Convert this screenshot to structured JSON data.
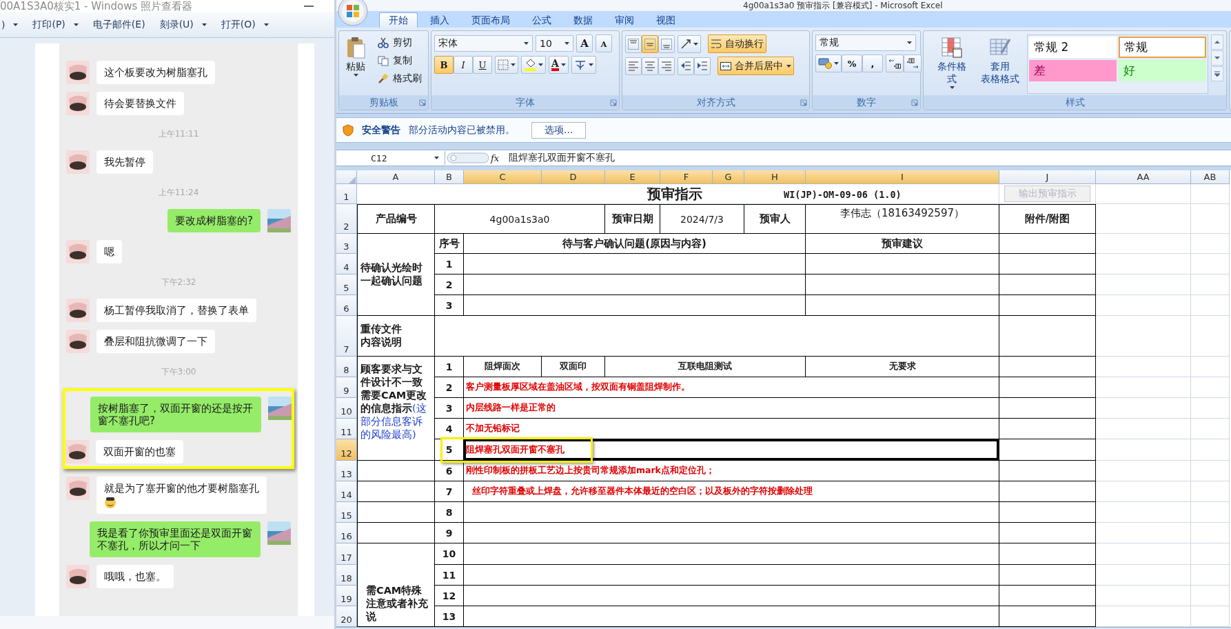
{
  "photo_viewer": {
    "title": "00A1S3A0核实1 - Windows 照片查看器",
    "menu": [
      {
        "label": ")",
        "dropdown": true
      },
      {
        "label": "打印(P)",
        "dropdown": true
      },
      {
        "label": "电子邮件(E)",
        "dropdown": false
      },
      {
        "label": "刻录(U)",
        "dropdown": true
      },
      {
        "label": "打开(O)",
        "dropdown": true
      }
    ],
    "chat": [
      {
        "kind": "incoming",
        "text": "这个板要改为树脂塞孔"
      },
      {
        "kind": "incoming",
        "text": "待会要替换文件"
      },
      {
        "kind": "time",
        "text": "上午11:11"
      },
      {
        "kind": "incoming",
        "text": "我先暂停"
      },
      {
        "kind": "time",
        "text": "上午11:24"
      },
      {
        "kind": "outgoing",
        "text": "要改成树脂塞的?"
      },
      {
        "kind": "incoming",
        "text": "嗯"
      },
      {
        "kind": "time",
        "text": "下午2:32"
      },
      {
        "kind": "incoming",
        "text": "杨工暂停我取消了，替换了表单"
      },
      {
        "kind": "incoming",
        "text": "叠层和阻抗微调了一下"
      },
      {
        "kind": "time",
        "text": "下午3:00"
      },
      {
        "kind": "highlight",
        "messages": [
          {
            "kind": "outgoing",
            "text": "按树脂塞了，双面开窗的还是按开窗不塞孔吧?"
          },
          {
            "kind": "incoming",
            "text": "双面开窗的也塞"
          }
        ]
      },
      {
        "kind": "incoming",
        "text": "就是为了塞开窗的他才要树脂塞孔",
        "emoji": true
      },
      {
        "kind": "outgoing",
        "text": "我是看了你预审里面还是双面开窗不塞孔，所以才问一下"
      },
      {
        "kind": "incoming",
        "text": "哦哦，也塞。"
      }
    ]
  },
  "excel": {
    "title": "4g00a1s3a0 预审指示 [兼容模式] - Microsoft Excel",
    "tabs": [
      {
        "label": "开始",
        "selected": true
      },
      {
        "label": "插入",
        "selected": false
      },
      {
        "label": "页面布局",
        "selected": false
      },
      {
        "label": "公式",
        "selected": false
      },
      {
        "label": "数据",
        "selected": false
      },
      {
        "label": "审阅",
        "selected": false
      },
      {
        "label": "视图",
        "selected": false
      }
    ],
    "groups": [
      {
        "kind": "clipboard",
        "label": "剪贴板",
        "launcher": true,
        "paste": "粘贴",
        "actions": [
          "剪切",
          "复制",
          "格式刷"
        ]
      },
      {
        "kind": "font",
        "label": "字体",
        "launcher": true,
        "font": "宋体",
        "size": "10",
        "grow": "A",
        "shrink": "A",
        "styles": [
          {
            "glyph": "B",
            "selected": true
          },
          {
            "glyph": "I",
            "selected": false
          },
          {
            "glyph": "U",
            "selected": false
          }
        ],
        "font_color": "A"
      },
      {
        "kind": "alignment",
        "label": "对齐方式",
        "launcher": true,
        "vertical": [
          {
            "selected": false
          },
          {
            "selected": true
          },
          {
            "selected": false
          }
        ],
        "wrap": {
          "label": "自动换行",
          "selected": true
        },
        "merge": {
          "label": "合并后居中",
          "selected": true
        }
      },
      {
        "kind": "number",
        "label": "数字",
        "launcher": true,
        "format": "常规",
        "symbols": [
          "%",
          ","
        ]
      },
      {
        "kind": "styles",
        "label": "样式",
        "launcher": false,
        "conditional": "条件格式",
        "table_format": [
          "套用",
          "表格格式"
        ],
        "gallery": [
          {
            "label": "常规 2",
            "kind": "normal",
            "color": "#ffffff",
            "selected": false
          },
          {
            "label": "常规",
            "kind": "normal",
            "color": "#ffffff",
            "selected": true
          },
          {
            "label": "差",
            "kind": "bad",
            "color": "#ff99cc",
            "selected": false
          },
          {
            "label": "好",
            "kind": "good",
            "color": "#ccffcc",
            "selected": false
          }
        ]
      }
    ],
    "security": {
      "title": "安全警告",
      "message": "部分活动内容已被禁用。",
      "button": "选项..."
    },
    "formula_bar": {
      "name_box": "C12",
      "fx": "fx",
      "formula": "阻焊塞孔双面开窗不塞孔"
    },
    "sheet": {
      "columns": [
        {
          "label": "A",
          "selected": false
        },
        {
          "label": "B",
          "selected": false
        },
        {
          "label": "C",
          "selected": true
        },
        {
          "label": "D",
          "selected": true
        },
        {
          "label": "E",
          "selected": true
        },
        {
          "label": "F",
          "selected": true
        },
        {
          "label": "G",
          "selected": true
        },
        {
          "label": "H",
          "selected": true
        },
        {
          "label": "I",
          "selected": true
        },
        {
          "label": "J",
          "selected": false
        },
        {
          "label": "AA",
          "selected": false
        },
        {
          "label": "AB",
          "selected": false
        }
      ],
      "rows": [
        {
          "label": "1",
          "selected": false,
          "highlighted": false,
          "cells": [
            "",
            "",
            "",
            "",
            "",
            {
              "kind": "title",
              "text": "预审指示",
              "selected": false
            },
            "",
            {
              "kind": "code",
              "text": "WI(JP)-OM-09-06 (1.0)",
              "selected": false
            },
            "",
            {
              "kind": "button",
              "text": "输出预审指示",
              "disabled": true,
              "selected": false
            }
          ]
        },
        {
          "label": "2",
          "selected": false,
          "highlighted": false,
          "cells": [
            {
              "kind": "header",
              "text": "产品编号",
              "selected": false
            },
            "",
            {
              "kind": "value",
              "text": "4g00a1s3a0",
              "selected": false
            },
            "",
            {
              "kind": "header",
              "text": "预审日期",
              "selected": false
            },
            {
              "kind": "value",
              "text": "2024/7/3",
              "selected": false
            },
            "",
            {
              "kind": "header",
              "text": "预审人",
              "selected": false
            },
            {
              "kind": "top-value",
              "text": "李伟志（18163492597）",
              "selected": false
            },
            {
              "kind": "header",
              "text": "附件/附图",
              "selected": false
            }
          ]
        },
        {
          "label": "3",
          "selected": false,
          "highlighted": false,
          "cells": [
            {
              "kind": "side",
              "text": "待确认光绘时一起确认问题",
              "selected": false
            },
            {
              "kind": "header",
              "text": "序号",
              "selected": false
            },
            {
              "kind": "header",
              "text": "待与客户确认问题(原因与内容)",
              "selected": false
            },
            "",
            "",
            "",
            "",
            "",
            {
              "kind": "header",
              "text": "预审建议",
              "selected": false
            }
          ]
        },
        {
          "label": "4",
          "selected": false,
          "highlighted": false,
          "cells": [
            "",
            {
              "kind": "number",
              "text": "1",
              "selected": false
            }
          ]
        },
        {
          "label": "5",
          "selected": false,
          "highlighted": false,
          "cells": [
            "",
            {
              "kind": "number",
              "text": "2",
              "selected": false
            }
          ]
        },
        {
          "label": "6",
          "selected": false,
          "highlighted": false,
          "cells": [
            "",
            {
              "kind": "number",
              "text": "3",
              "selected": false
            }
          ]
        },
        {
          "label": "7",
          "selected": false,
          "highlighted": false,
          "cells": [
            {
              "kind": "side",
              "text": "重传文件内容说明",
              "selected": false
            }
          ]
        },
        {
          "label": "8",
          "selected": false,
          "highlighted": false,
          "cells": [
            {
              "kind": "side",
              "text": "顾客要求与文件设计不一致需要CAM更改的信息指示",
              "note": "(这部分信息客诉的风险最高)",
              "selected": false
            },
            {
              "kind": "number",
              "text": "1",
              "selected": false
            },
            {
              "kind": "small-header",
              "text": "阻焊面次",
              "selected": false
            },
            {
              "kind": "small-header",
              "text": "双面印",
              "selected": false
            },
            "",
            {
              "kind": "small-header",
              "text": "互联电阻测试",
              "selected": false
            },
            "",
            "",
            {
              "kind": "small-header",
              "text": "无要求",
              "selected": false
            }
          ]
        },
        {
          "label": "9",
          "selected": false,
          "highlighted": false,
          "cells": [
            "",
            {
              "kind": "number",
              "text": "2",
              "selected": false
            },
            {
              "kind": "red",
              "text": "客户测量板厚区域在盖油区域，按双面有铜盖阻焊制作。",
              "selected": false
            }
          ]
        },
        {
          "label": "10",
          "selected": false,
          "highlighted": false,
          "cells": [
            "",
            {
              "kind": "number",
              "text": "3",
              "selected": false
            },
            {
              "kind": "red",
              "text": "内层线路一样是正常的",
              "selected": false
            }
          ]
        },
        {
          "label": "11",
          "selected": false,
          "highlighted": false,
          "cells": [
            "",
            {
              "kind": "number",
              "text": "4",
              "selected": false
            },
            {
              "kind": "red",
              "text": "不加无铅标记",
              "selected": false
            }
          ]
        },
        {
          "label": "12",
          "selected": true,
          "highlighted": true,
          "cells": [
            "",
            {
              "kind": "number",
              "text": "5",
              "selected": false
            },
            {
              "kind": "red",
              "text": "阻焊塞孔双面开窗不塞孔",
              "selected": true
            }
          ]
        },
        {
          "label": "13",
          "selected": false,
          "highlighted": false,
          "cells": [
            "",
            {
              "kind": "number",
              "text": "6",
              "selected": false
            },
            {
              "kind": "red",
              "text": "刚性印制板的拼板工艺边上按贵司常规添加mark点和定位孔；",
              "selected": false
            }
          ]
        },
        {
          "label": "14",
          "selected": false,
          "highlighted": false,
          "cells": [
            "",
            {
              "kind": "number",
              "text": "7",
              "selected": false
            },
            {
              "kind": "red",
              "text": "  丝印字符重叠或上焊盘，允许移至器件本体最近的空白区；以及板外的字符按删除处理",
              "selected": false
            }
          ]
        },
        {
          "label": "15",
          "selected": false,
          "highlighted": false,
          "cells": [
            "",
            {
              "kind": "number",
              "text": "8",
              "selected": false
            }
          ]
        },
        {
          "label": "16",
          "selected": false,
          "highlighted": false,
          "cells": [
            "",
            {
              "kind": "number",
              "text": "9",
              "selected": false
            }
          ]
        },
        {
          "label": "17",
          "selected": false,
          "highlighted": false,
          "cells": [
            "",
            {
              "kind": "number",
              "text": "10",
              "selected": false
            }
          ]
        },
        {
          "label": "18",
          "selected": false,
          "highlighted": false,
          "cells": [
            "",
            {
              "kind": "number",
              "text": "11",
              "selected": false
            }
          ]
        },
        {
          "label": "19",
          "selected": false,
          "highlighted": false,
          "cells": [
            "",
            {
              "kind": "number",
              "text": "12",
              "selected": false
            }
          ]
        },
        {
          "label": "20",
          "selected": false,
          "highlighted": false,
          "cells": [
            {
              "kind": "side-bottom",
              "text": "需CAM特殊注意或者补充说",
              "selected": false
            },
            {
              "kind": "number",
              "text": "13",
              "selected": false
            }
          ]
        }
      ]
    }
  }
}
